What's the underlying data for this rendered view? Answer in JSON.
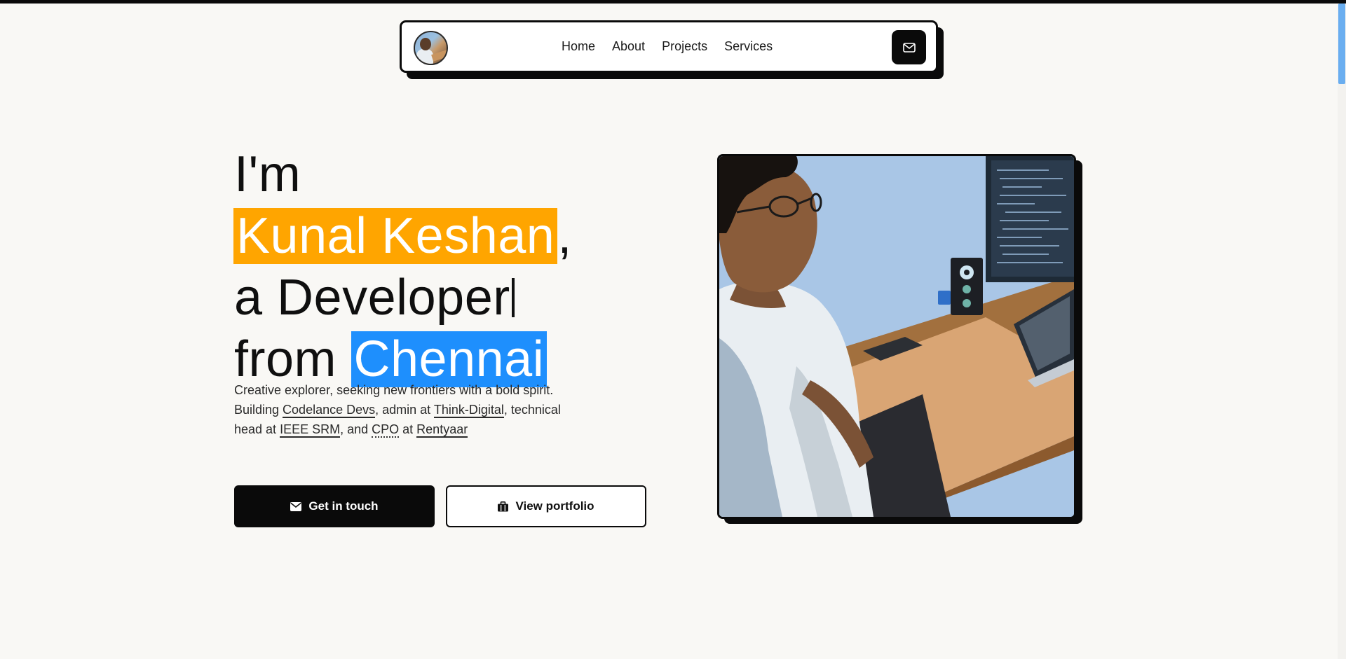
{
  "nav": {
    "avatar_alt": "Profile avatar",
    "links": [
      "Home",
      "About",
      "Projects",
      "Services"
    ],
    "mail_icon": "mail-icon"
  },
  "hero": {
    "line1": "I'm",
    "name": "Kunal Keshan",
    "name_suffix": ",",
    "line3": "a Developer",
    "line4_prefix": "from ",
    "city": "Chennai",
    "colors": {
      "name_bg": "#ffa500",
      "city_bg": "#1e8ffd"
    }
  },
  "bio": {
    "line1": "Creative explorer, seeking new frontiers with a bold spirit.",
    "building": "Building ",
    "codelance": "Codelance Devs",
    "admin_at": ", admin at ",
    "think_digital": "Think-Digital",
    "technical": ", technical",
    "head_at": "head at ",
    "ieee": "IEEE SRM",
    "and": ", and ",
    "cpo": "CPO",
    "at": " at ",
    "rentyaar": "Rentyaar"
  },
  "buttons": {
    "contact": {
      "label": "Get in touch",
      "icon": "envelope-icon"
    },
    "portfolio": {
      "label": "View portfolio",
      "icon": "briefcase-icon"
    }
  },
  "illustration": {
    "alt": "Illustration of developer at desk with monitor"
  }
}
